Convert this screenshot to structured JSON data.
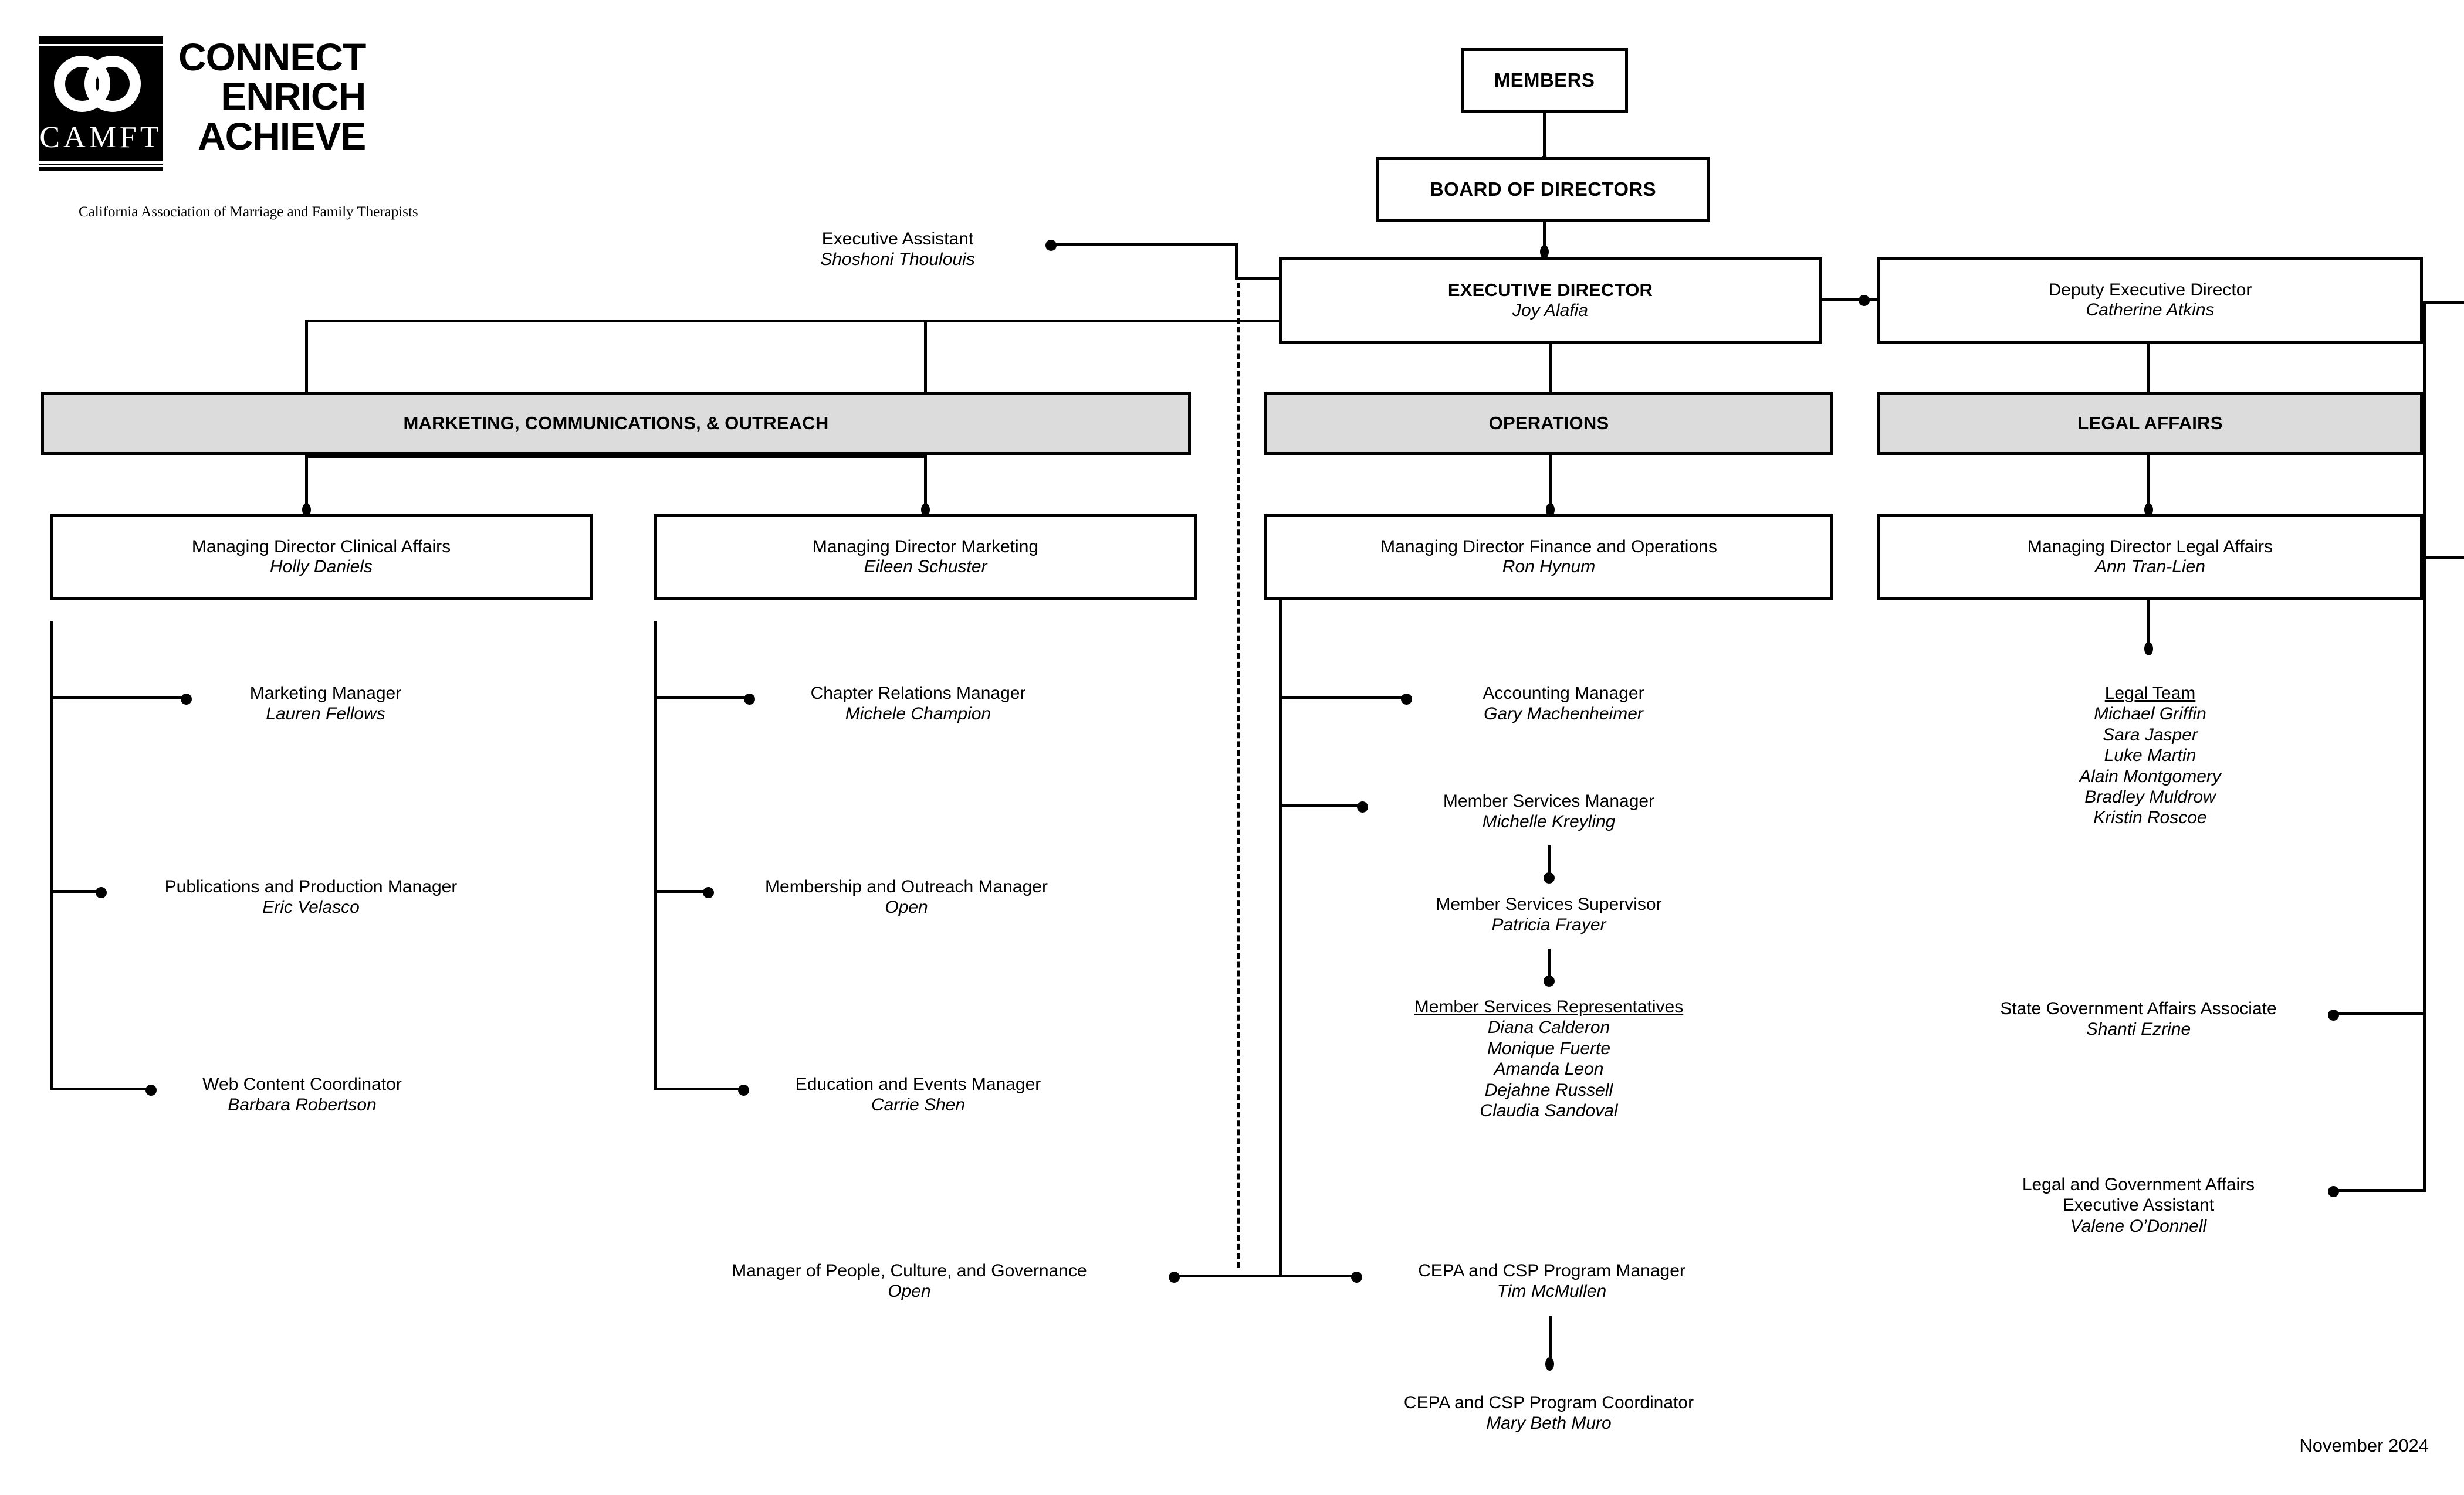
{
  "logo": {
    "mark_text": "CAMFT",
    "tagline_lines": [
      "CONNECT",
      "ENRICH",
      "ACHIEVE"
    ],
    "association_name": "California Association of Marriage and Family Therapists"
  },
  "top": {
    "members": "MEMBERS",
    "board": "BOARD OF DIRECTORS",
    "executive_director": {
      "role": "EXECUTIVE DIRECTOR",
      "name": "Joy Alafia"
    },
    "deputy_executive_director": {
      "role": "Deputy Executive Director",
      "name": "Catherine Atkins"
    },
    "executive_assistant": {
      "role": "Executive Assistant",
      "name": "Shoshoni Thoulouis"
    }
  },
  "divisions": {
    "marketing": "MARKETING, COMMUNICATIONS, & OUTREACH",
    "operations": "OPERATIONS",
    "legal": "LEGAL AFFAIRS"
  },
  "managing_directors": {
    "clinical_affairs": {
      "role": "Managing Director Clinical Affairs",
      "name": "Holly Daniels"
    },
    "marketing": {
      "role": "Managing Director Marketing",
      "name": "Eileen Schuster"
    },
    "finance_operations": {
      "role": "Managing Director Finance and Operations",
      "name": "Ron Hynum"
    },
    "legal_affairs": {
      "role": "Managing Director Legal Affairs",
      "name": "Ann Tran-Lien"
    }
  },
  "clinical_affairs_reports": [
    {
      "role": "Marketing Manager",
      "name": "Lauren Fellows"
    },
    {
      "role": "Publications and Production Manager",
      "name": "Eric Velasco"
    },
    {
      "role": "Web Content Coordinator",
      "name": "Barbara Robertson"
    }
  ],
  "marketing_reports": [
    {
      "role": "Chapter Relations Manager",
      "name": "Michele Champion"
    },
    {
      "role": "Membership and Outreach Manager",
      "name": "Open"
    },
    {
      "role": "Education and Events Manager",
      "name": "Carrie Shen"
    }
  ],
  "operations_reports": {
    "accounting_manager": {
      "role": "Accounting Manager",
      "name": "Gary Machenheimer"
    },
    "member_services_manager": {
      "role": "Member Services Manager",
      "name": "Michelle Kreyling"
    },
    "member_services_supervisor": {
      "role": "Member Services Supervisor",
      "name": "Patricia Frayer"
    },
    "member_services_representatives": {
      "role": "Member Services Representatives",
      "names": [
        "Diana Calderon",
        "Monique Fuerte",
        "Amanda Leon",
        "Dejahne Russell",
        "Claudia Sandoval"
      ]
    }
  },
  "legal_reports": {
    "legal_team": {
      "role": "Legal Team",
      "names": [
        "Michael Griffin",
        "Sara Jasper",
        "Luke Martin",
        "Alain Montgomery",
        "Bradley Muldrow",
        "Kristin Roscoe"
      ]
    },
    "state_gov_affairs": {
      "role": "State Government Affairs Associate",
      "name": "Shanti Ezrine"
    },
    "legal_gov_affairs_ea": {
      "role_line1": "Legal and Government Affairs",
      "role_line2": "Executive Assistant",
      "name": "Valene O’Donnell"
    }
  },
  "bottom": {
    "people_culture": {
      "role": "Manager of People, Culture, and Governance",
      "name": "Open"
    },
    "cepa_manager": {
      "role": "CEPA and CSP Program Manager",
      "name": "Tim McMullen"
    },
    "cepa_coordinator": {
      "role": "CEPA and CSP Program Coordinator",
      "name": "Mary Beth Muro"
    }
  },
  "footer": {
    "date": "November 2024"
  },
  "colors": {
    "band_fill": "#dcdcdc",
    "line": "#000000",
    "background": "#ffffff"
  }
}
